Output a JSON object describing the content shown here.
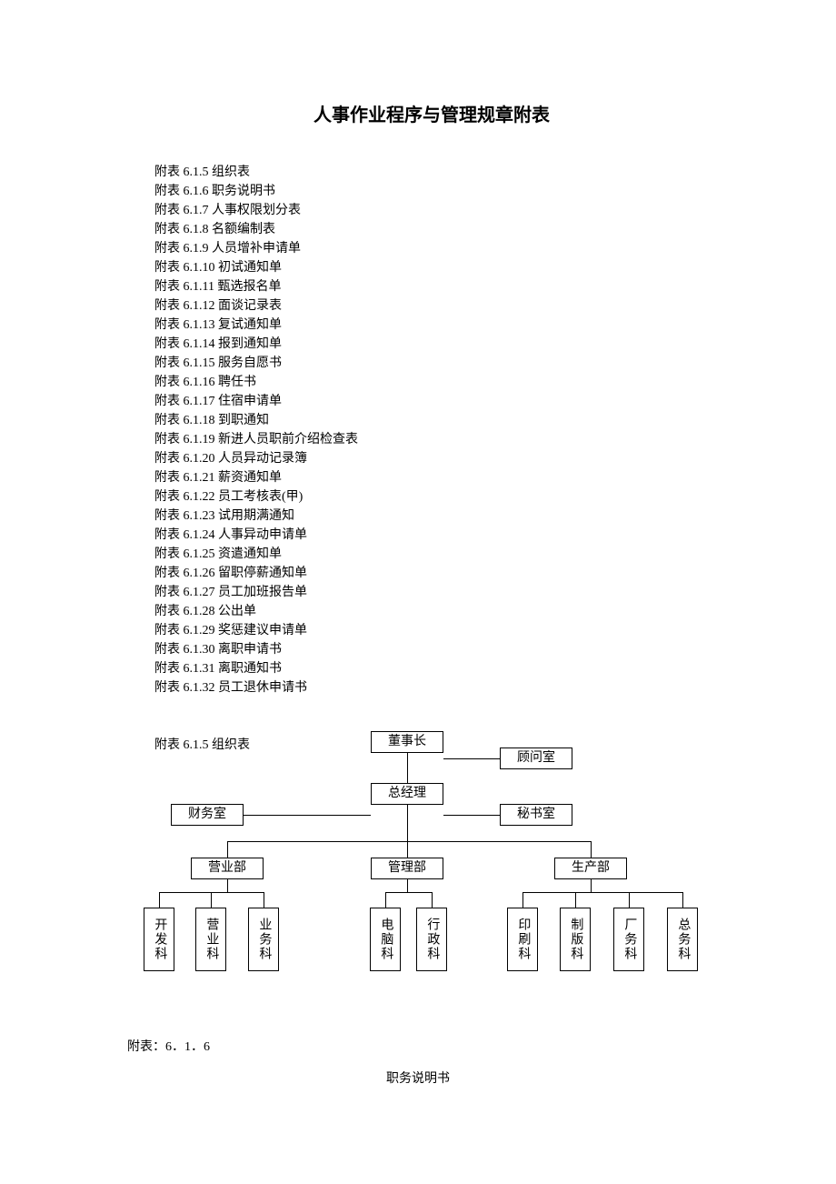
{
  "title": "人事作业程序与管理规章附表",
  "list": [
    " 附表 6.1.5 组织表",
    "附表 6.1.6 职务说明书",
    "附表 6.1.7 人事权限划分表",
    "附表 6.1.8 名额编制表",
    "附表 6.1.9 人员增补申请单",
    "附表 6.1.10 初试通知单",
    "附表 6.1.11 甄选报名单",
    "附表 6.1.12 面谈记录表",
    "附表 6.1.13 复试通知单",
    "附表 6.1.14 报到通知单",
    "附表 6.1.15 服务自愿书",
    "附表 6.1.16 聘任书",
    "附表 6.1.17 住宿申请单",
    "附表 6.1.18 到职通知",
    "附表 6.1.19 新进人员职前介绍检查表",
    "附表 6.1.20 人员异动记录簿",
    "附表 6.1.21 薪资通知单",
    "附表 6.1.22 员工考核表(甲)",
    "附表 6.1.23 试用期满通知",
    "附表 6.1.24 人事异动申请单",
    "附表 6.1.25 资遣通知单",
    "附表 6.1.26 留职停薪通知单",
    "附表 6.1.27 员工加班报告单",
    "附表 6.1.28 公出单",
    "附表 6.1.29 奖惩建议申请单",
    "附表 6.1.30 离职申请书",
    "附表 6.1.31 离职通知书",
    " 附表 6.1.32 员工退休申请书"
  ],
  "chart_label": "附表 6.1.5 组织表",
  "chart_data": {
    "type": "org-chart",
    "nodes": {
      "chairman": "董事长",
      "advisor": "顾问室",
      "gm": "总经理",
      "finance": "财务室",
      "secretary": "秘书室",
      "sales_dept": "营业部",
      "admin_dept": "管理部",
      "prod_dept": "生产部",
      "dev": "开发科",
      "sales": "营业科",
      "biz": "业务科",
      "it": "电脑科",
      "admin": "行政科",
      "print": "印刷科",
      "plate": "制版科",
      "factory": "厂务科",
      "general": "总务科"
    }
  },
  "next_label": "附表：6．1．6",
  "next_title": "职务说明书"
}
